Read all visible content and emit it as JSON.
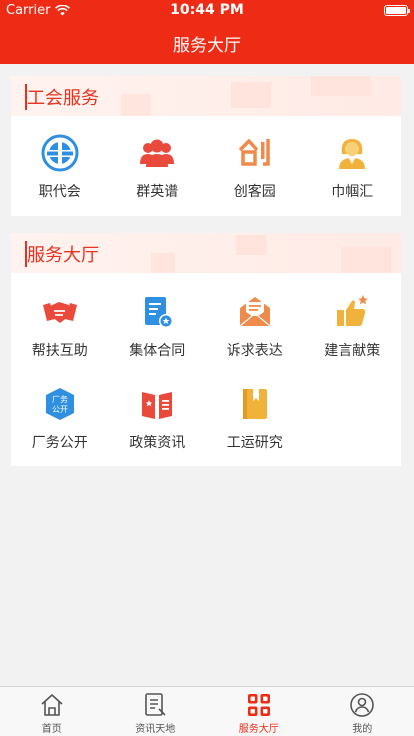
{
  "status_bar": {
    "carrier": "Carrier",
    "time": "10:44 PM"
  },
  "nav": {
    "title": "服务大厅"
  },
  "sections": [
    {
      "title": "工会服务",
      "items": [
        {
          "label": "职代会",
          "icon": "union-logo-icon"
        },
        {
          "label": "群英谱",
          "icon": "group-people-icon"
        },
        {
          "label": "创客园",
          "icon": "chuang-character-icon"
        },
        {
          "label": "巾帼汇",
          "icon": "woman-icon"
        }
      ]
    },
    {
      "title": "服务大厅",
      "items": [
        {
          "label": "帮扶互助",
          "icon": "handshake-icon"
        },
        {
          "label": "集体合同",
          "icon": "contract-document-icon"
        },
        {
          "label": "诉求表达",
          "icon": "open-envelope-icon"
        },
        {
          "label": "建言献策",
          "icon": "thumbs-up-icon"
        },
        {
          "label": "厂务公开",
          "icon": "factory-affairs-badge-icon"
        },
        {
          "label": "政策资讯",
          "icon": "policy-book-icon"
        },
        {
          "label": "工运研究",
          "icon": "research-book-icon"
        }
      ]
    }
  ],
  "tabbar": [
    {
      "label": "首页",
      "icon": "home-icon",
      "active": false
    },
    {
      "label": "资讯天地",
      "icon": "news-document-icon",
      "active": false
    },
    {
      "label": "服务大厅",
      "icon": "service-grid-icon",
      "active": true
    },
    {
      "label": "我的",
      "icon": "user-profile-icon",
      "active": false
    }
  ],
  "colors": {
    "brand": "#ee2b14",
    "accent_text": "#e8321e",
    "blue_icon": "#2f8fe0",
    "orange_icon": "#f08a4b",
    "gold_icon": "#f0b23a"
  }
}
